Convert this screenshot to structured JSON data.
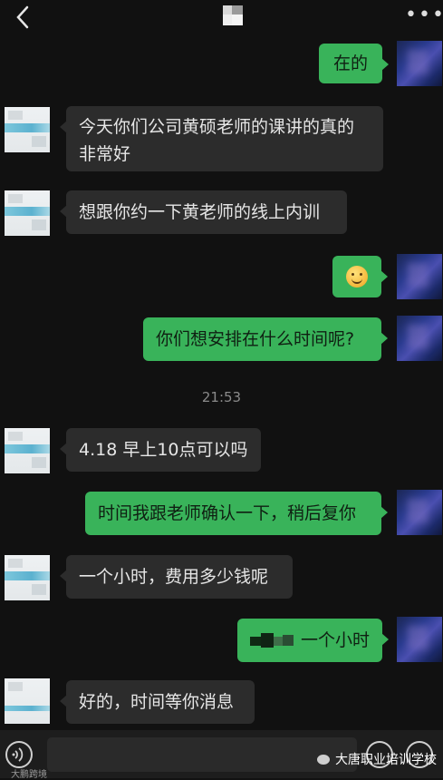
{
  "header": {
    "back": "back-icon",
    "menu": "more-icon"
  },
  "messages": [
    {
      "side": "right",
      "text": "在的"
    },
    {
      "side": "left",
      "text": "今天你们公司黄硕老师的课讲的真的非常好"
    },
    {
      "side": "left",
      "text": "想跟你约一下黄老师的线上内训"
    },
    {
      "side": "right",
      "emoji": "smile-emoji"
    },
    {
      "side": "right",
      "text": "你们想安排在什么时间呢?"
    },
    {
      "side": "left",
      "text": "4.18 早上10点可以吗"
    },
    {
      "side": "right",
      "text": "时间我跟老师确认一下，稍后复你"
    },
    {
      "side": "left",
      "text": "一个小时，费用多少钱呢"
    },
    {
      "side": "right",
      "text": "一个小时"
    },
    {
      "side": "left",
      "text": "好的，时间等你消息"
    }
  ],
  "timestamp": "21:53",
  "footer": {
    "watermark": "大唐职业培训学校",
    "watermark_small": "大鹏跨境"
  },
  "colors": {
    "green_bubble": "#39b35a",
    "gray_bubble": "#2c2c2c",
    "background": "#111111"
  }
}
